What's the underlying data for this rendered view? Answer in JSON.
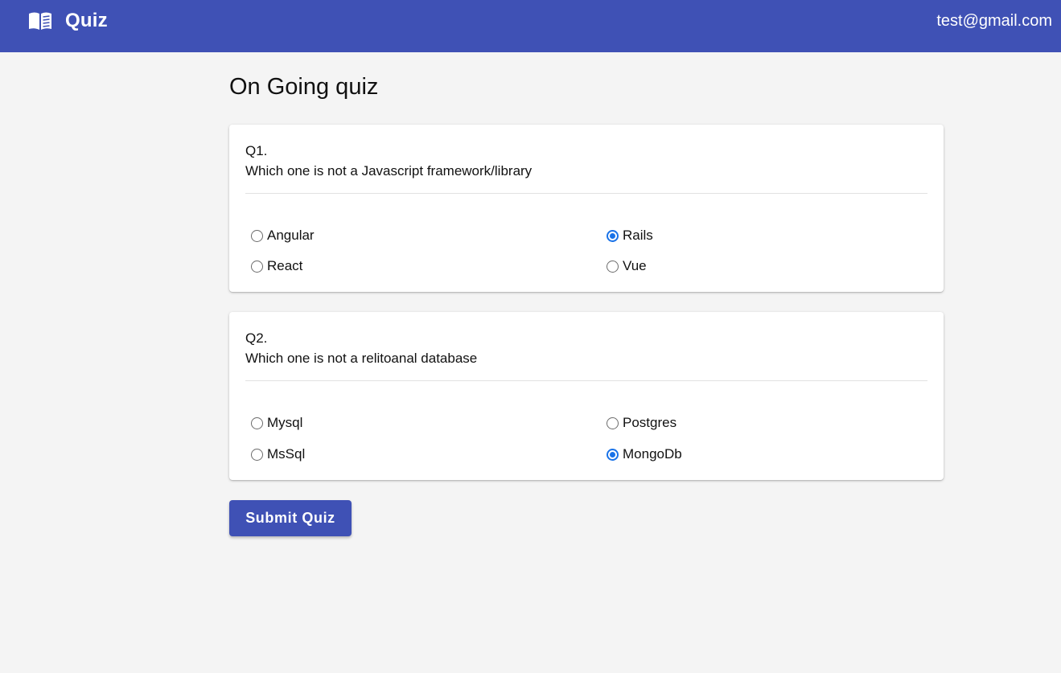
{
  "appbar": {
    "title": "Quiz",
    "logo_icon": "open-book-icon",
    "user_email": "test@gmail.com",
    "color": "#3f51b5"
  },
  "page": {
    "title": "On Going quiz"
  },
  "questions": [
    {
      "number": "Q1.",
      "text": "Which one is not a Javascript framework/library",
      "options": [
        {
          "label": "Angular",
          "selected": false
        },
        {
          "label": "Rails",
          "selected": true
        },
        {
          "label": "React",
          "selected": false
        },
        {
          "label": "Vue",
          "selected": false
        }
      ]
    },
    {
      "number": "Q2.",
      "text": "Which one is not a relitoanal database",
      "options": [
        {
          "label": "Mysql",
          "selected": false
        },
        {
          "label": "Postgres",
          "selected": false
        },
        {
          "label": "MsSql",
          "selected": false
        },
        {
          "label": "MongoDb",
          "selected": true
        }
      ]
    }
  ],
  "submit": {
    "label": "Submit Quiz"
  },
  "colors": {
    "accent": "#3f51b5",
    "radio_checked": "#1a73e8",
    "background": "#f4f4f4"
  }
}
